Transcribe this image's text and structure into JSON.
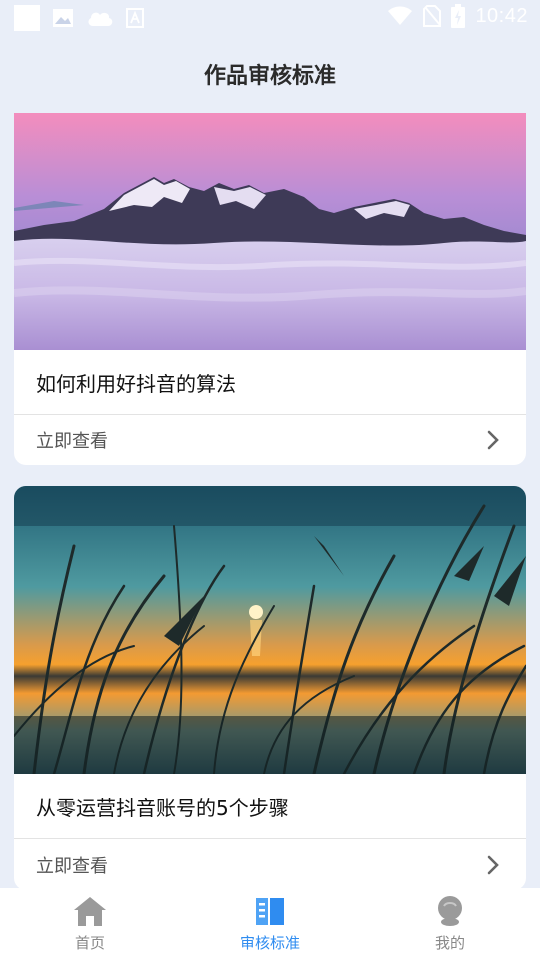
{
  "status_bar": {
    "time": "10:42",
    "left_icons": [
      "app-square-icon",
      "gallery-icon",
      "cloud-icon",
      "font-icon"
    ],
    "right_icons": [
      "wifi-icon",
      "no-sim-icon",
      "battery-charging-icon"
    ]
  },
  "header": {
    "title": "作品审核标准"
  },
  "articles": [
    {
      "title": "如何利用好抖音的算法",
      "action": "立即查看",
      "image": "mountain-sea-of-clouds"
    },
    {
      "title": "从零运营抖音账号的5个步骤",
      "action": "立即查看",
      "image": "reeds-lake-sunset"
    }
  ],
  "tabs": [
    {
      "label": "首页",
      "icon": "home-icon",
      "active": false
    },
    {
      "label": "审核标准",
      "icon": "book-icon",
      "active": true
    },
    {
      "label": "我的",
      "icon": "profile-icon",
      "active": false
    }
  ],
  "colors": {
    "accent": "#2f8cf0",
    "background": "#e9eef8",
    "inactive": "#888888"
  }
}
